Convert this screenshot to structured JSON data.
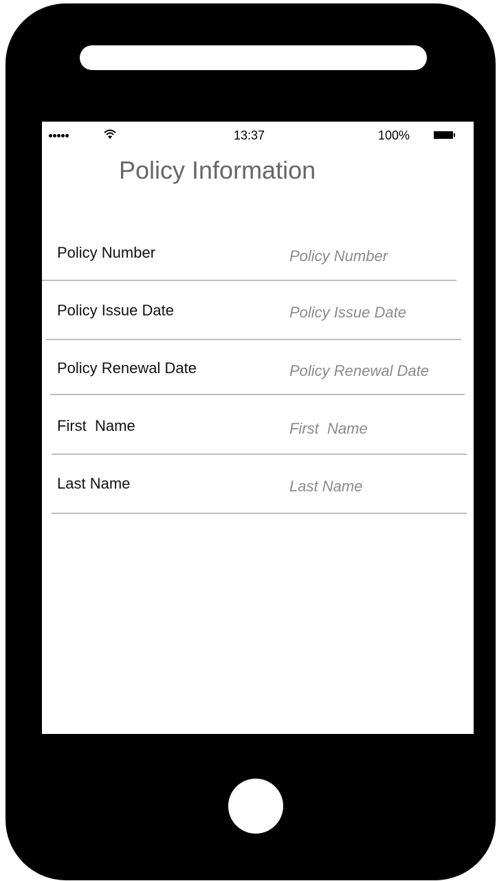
{
  "status_bar": {
    "time": "13:37",
    "battery": "100%",
    "signal_icon": "signal-dots-icon",
    "wifi_icon": "wifi-icon",
    "battery_icon": "battery-full-icon"
  },
  "page": {
    "title": "Policy Information"
  },
  "form": {
    "fields": [
      {
        "label": "Policy Number",
        "placeholder": "Policy Number",
        "value": ""
      },
      {
        "label": "Policy Issue Date",
        "placeholder": "Policy Issue Date",
        "value": ""
      },
      {
        "label": "Policy Renewal Date",
        "placeholder": "Policy Renewal Date",
        "value": ""
      },
      {
        "label": "First  Name",
        "placeholder": "First  Name",
        "value": ""
      },
      {
        "label": "Last Name",
        "placeholder": "Last Name",
        "value": ""
      }
    ]
  },
  "colors": {
    "device_frame": "#000000",
    "screen_background": "#ffffff",
    "title_text": "#666666",
    "label_text": "#111111",
    "placeholder_text": "#8a8a8a",
    "divider": "#bdbdbd"
  }
}
